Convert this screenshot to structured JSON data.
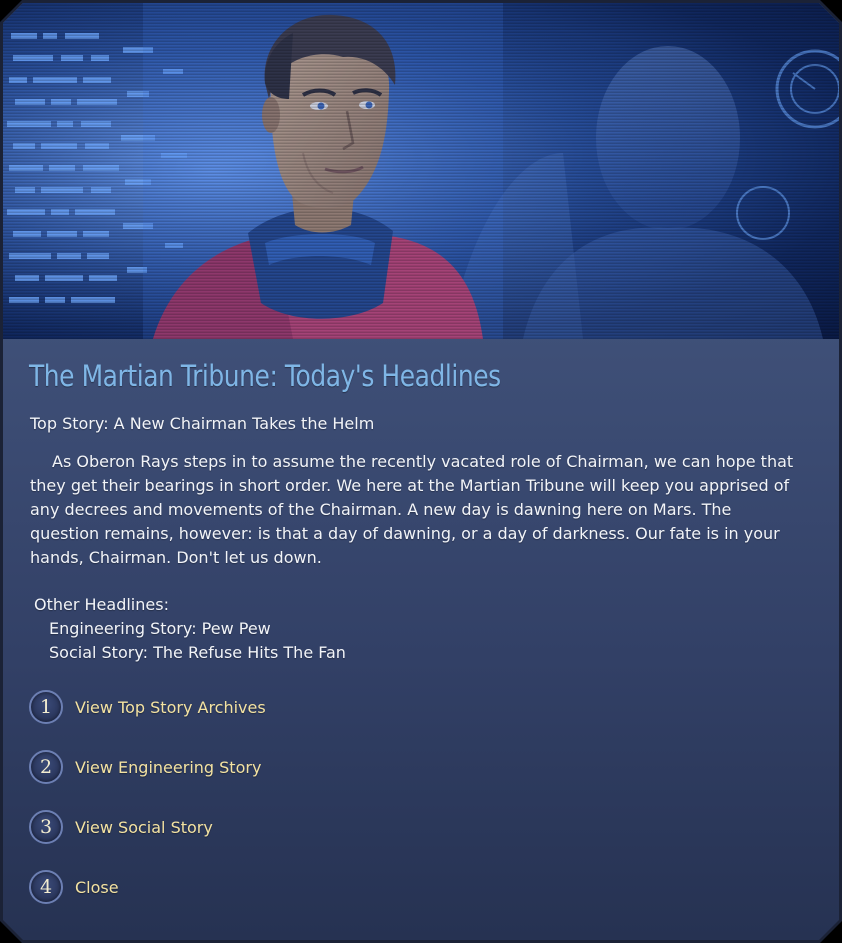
{
  "header": {
    "title": "The Martian Tribune:  Today's Headlines"
  },
  "top_story": {
    "heading": "Top Story:  A New Chairman Takes the Helm",
    "body": "As Oberon Rays steps in to assume the recently vacated role of Chairman, we can hope that they get their bearings in short order.  We here at the Martian Tribune will keep you apprised of any decrees and movements of the Chairman.  A new day is dawning here on Mars.  The question remains, however: is that a day of dawning, or a day of darkness.  Our fate is in your hands, Chairman.  Don't let us down."
  },
  "other_headlines": {
    "heading": "Other Headlines:",
    "items": [
      "Engineering Story:  Pew Pew",
      "Social Story:  The Refuse Hits The Fan"
    ]
  },
  "options": [
    {
      "number": "1",
      "label": "View Top Story Archives"
    },
    {
      "number": "2",
      "label": "View Engineering Story"
    },
    {
      "number": "3",
      "label": "View Social Story"
    },
    {
      "number": "4",
      "label": "Close"
    }
  ],
  "colors": {
    "title": "#7fb6e6",
    "option_text": "#f3e2a2",
    "panel_top": "#4a5c86",
    "panel_bottom": "#263252",
    "hero_glow": "#4f7fd8"
  }
}
